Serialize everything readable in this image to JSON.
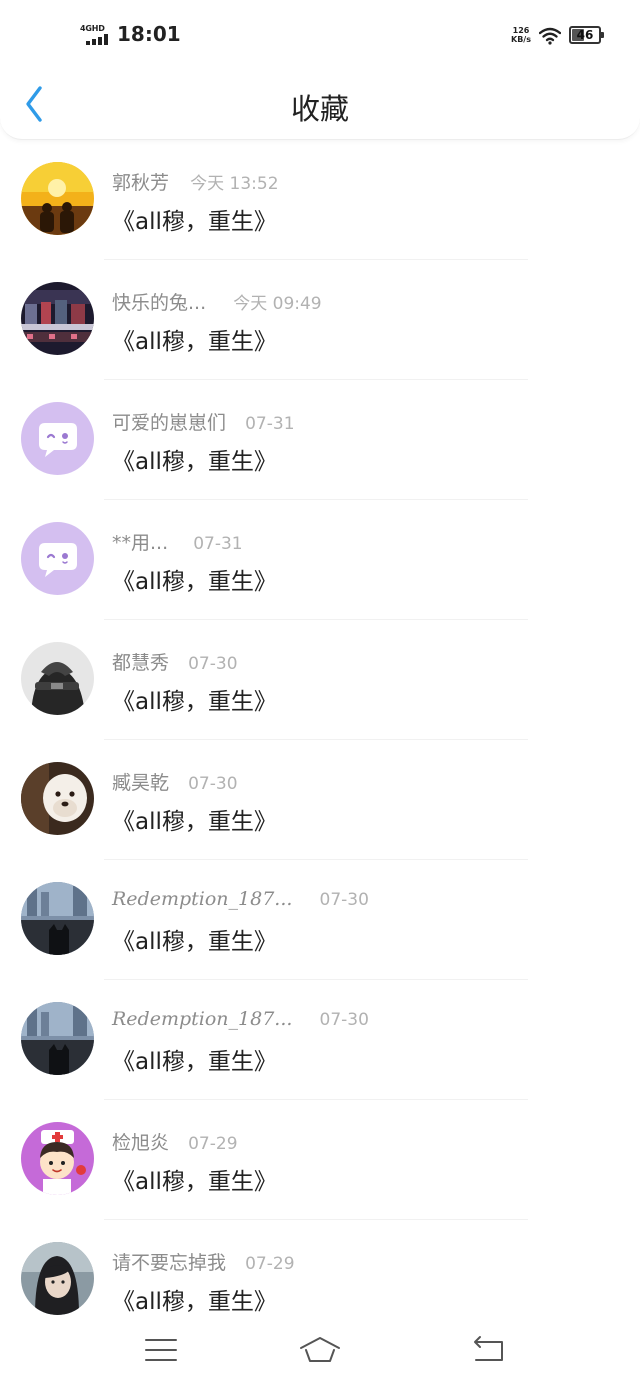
{
  "status_bar": {
    "network": "4GHD",
    "time": "18:01",
    "speed_value": "126",
    "speed_unit": "KB/s",
    "battery": "46"
  },
  "header": {
    "back_icon": "chevron-left-icon",
    "title": "收藏",
    "accent_color": "#2f9be8"
  },
  "favorites": [
    {
      "name": "郭秋芳",
      "time": "今天 13:52",
      "content": "《all穆，重生》"
    },
    {
      "name": "快乐的兔...",
      "time": "今天 09:49",
      "content": "《all穆，重生》"
    },
    {
      "name": "可爱的崽崽们",
      "time": "07-31",
      "content": "《all穆，重生》"
    },
    {
      "name": "**用...",
      "time": "07-31",
      "content": "《all穆，重生》"
    },
    {
      "name": "都慧秀",
      "time": "07-30",
      "content": "《all穆，重生》"
    },
    {
      "name": "臧昊乾",
      "time": "07-30",
      "content": "《all穆，重生》"
    },
    {
      "name": "Redemption_187...",
      "time": "07-30",
      "content": "《all穆，重生》"
    },
    {
      "name": "Redemption_187...",
      "time": "07-30",
      "content": "《all穆，重生》"
    },
    {
      "name": "检旭炎",
      "time": "07-29",
      "content": "《all穆，重生》"
    },
    {
      "name": "请不要忘掉我",
      "time": "07-29",
      "content": "《all穆，重生》"
    }
  ],
  "bottom_nav": {
    "menu_icon": "menu-icon",
    "home_icon": "home-icon",
    "back_icon": "return-icon"
  }
}
